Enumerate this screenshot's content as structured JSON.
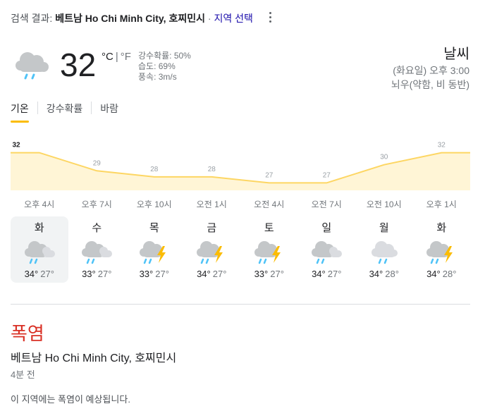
{
  "header": {
    "prefix": "검색 결과:",
    "location": "베트남 Ho Chi Minh City, 호찌민시",
    "separator": "·",
    "change_location": "지역 선택"
  },
  "current": {
    "icon": "rain-cloud-icon",
    "temperature": "32",
    "unit_c": "°C",
    "unit_sep": "|",
    "unit_f": "°F",
    "precipitation": "강수확률: 50%",
    "humidity": "습도: 69%",
    "wind": "풍속: 3m/s",
    "title": "날씨",
    "datetime": "(화요일) 오후 3:00",
    "condition": "뇌우(약함, 비 동반)"
  },
  "tabs": [
    {
      "label": "기온",
      "active": true
    },
    {
      "label": "강수확률",
      "active": false
    },
    {
      "label": "바람",
      "active": false
    }
  ],
  "chart_data": {
    "type": "area",
    "series": [
      {
        "values": [
          32,
          29,
          28,
          28,
          27,
          27,
          30,
          32
        ]
      }
    ],
    "x": [
      "오후 4시",
      "오후 7시",
      "오후 10시",
      "오전 1시",
      "오전 4시",
      "오전 7시",
      "오전 10시",
      "오후 1시"
    ],
    "labels": [
      "32",
      "29",
      "28",
      "28",
      "27",
      "27",
      "30",
      "32"
    ],
    "fill_color": "#fff5d6",
    "line_color": "#fdd663"
  },
  "days": [
    {
      "name": "화",
      "icon": "rain-cloud-icon",
      "high": "34°",
      "low": "27°",
      "selected": true
    },
    {
      "name": "수",
      "icon": "rain-cloud-icon",
      "high": "33°",
      "low": "27°",
      "selected": false
    },
    {
      "name": "목",
      "icon": "thunderstorm-icon",
      "high": "33°",
      "low": "27°",
      "selected": false
    },
    {
      "name": "금",
      "icon": "thunderstorm-icon",
      "high": "34°",
      "low": "27°",
      "selected": false
    },
    {
      "name": "토",
      "icon": "thunderstorm-icon",
      "high": "33°",
      "low": "27°",
      "selected": false
    },
    {
      "name": "일",
      "icon": "rain-cloud-icon",
      "high": "34°",
      "low": "27°",
      "selected": false
    },
    {
      "name": "월",
      "icon": "rain-light-icon",
      "high": "34°",
      "low": "28°",
      "selected": false
    },
    {
      "name": "화",
      "icon": "thunderstorm-icon",
      "high": "34°",
      "low": "28°",
      "selected": false
    }
  ],
  "alert": {
    "title": "폭염",
    "location": "베트남 Ho Chi Minh City, 호찌민시",
    "time": "4분 전",
    "description": "이 지역에는 폭염이 예상됩니다."
  },
  "colors": {
    "alert_red": "#d93025",
    "accent_yellow": "#fbbc04",
    "link_blue": "#1a0dab"
  }
}
